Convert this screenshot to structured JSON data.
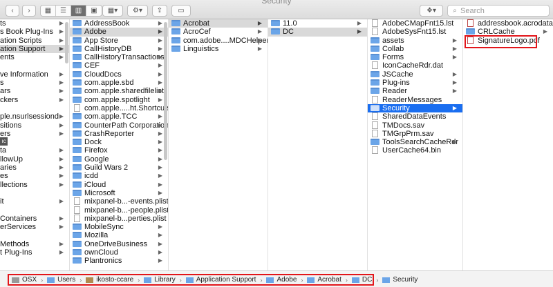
{
  "window": {
    "title": "Security"
  },
  "toolbar": {
    "search_placeholder": "Search",
    "view_icons": [
      "icon-view-icon",
      "list-view-icon",
      "column-view-icon",
      "cover-flow-icon"
    ]
  },
  "columns": [
    {
      "name": "library-column",
      "items": [
        {
          "label": "ts",
          "arrow": true
        },
        {
          "label": "s Book Plug-Ins",
          "arrow": true
        },
        {
          "label": "ation Scripts",
          "arrow": true
        },
        {
          "label": "ation Support",
          "arrow": true,
          "selected": "gray"
        },
        {
          "label": "ents",
          "arrow": true
        },
        {
          "label": "",
          "arrow": false
        },
        {
          "label": "ve Information",
          "arrow": true
        },
        {
          "label": "s",
          "arrow": true
        },
        {
          "label": "ars",
          "arrow": true
        },
        {
          "label": "ckers",
          "arrow": true
        },
        {
          "label": "",
          "arrow": false
        },
        {
          "label": "ple.nsurlsessiond",
          "arrow": true
        },
        {
          "label": "sitions",
          "arrow": true
        },
        {
          "label": "ers",
          "arrow": true
        },
        {
          "label": "",
          "arrow": false
        },
        {
          "label": "ta",
          "arrow": true
        },
        {
          "label": "llowUp",
          "arrow": true
        },
        {
          "label": "aries",
          "arrow": true
        },
        {
          "label": "es",
          "arrow": true
        },
        {
          "label": "llections",
          "arrow": true
        },
        {
          "label": "",
          "arrow": false
        },
        {
          "label": "it",
          "arrow": true
        },
        {
          "label": "",
          "arrow": false
        },
        {
          "label": "Containers",
          "arrow": true
        },
        {
          "label": "erServices",
          "arrow": true
        },
        {
          "label": "",
          "arrow": false
        },
        {
          "label": "Methods",
          "arrow": true
        },
        {
          "label": "t Plug-Ins",
          "arrow": true
        }
      ]
    },
    {
      "name": "application-support-column",
      "items": [
        {
          "label": "AddressBook",
          "arrow": true
        },
        {
          "label": "Adobe",
          "arrow": true,
          "selected": "gray"
        },
        {
          "label": "App Store",
          "arrow": true
        },
        {
          "label": "CallHistoryDB",
          "arrow": true
        },
        {
          "label": "CallHistoryTransactions",
          "arrow": true
        },
        {
          "label": "CEF",
          "arrow": true
        },
        {
          "label": "CloudDocs",
          "arrow": true
        },
        {
          "label": "com.apple.sbd",
          "arrow": true
        },
        {
          "label": "com.apple.sharedfilelist",
          "arrow": true
        },
        {
          "label": "com.apple.spotlight",
          "arrow": true
        },
        {
          "label": "com.apple.....ht.Shortcuts",
          "arrow": false,
          "file": true
        },
        {
          "label": "com.apple.TCC",
          "arrow": true
        },
        {
          "label": "CounterPath Corporation",
          "arrow": true
        },
        {
          "label": "CrashReporter",
          "arrow": true
        },
        {
          "label": "Dock",
          "arrow": true
        },
        {
          "label": "Firefox",
          "arrow": true
        },
        {
          "label": "Google",
          "arrow": true
        },
        {
          "label": "Guild Wars 2",
          "arrow": true
        },
        {
          "label": "icdd",
          "arrow": true
        },
        {
          "label": "iCloud",
          "arrow": true
        },
        {
          "label": "Microsoft",
          "arrow": true
        },
        {
          "label": "mixpanel-b...-events.plist",
          "arrow": false,
          "file": true
        },
        {
          "label": "mixpanel-b...-people.plist",
          "arrow": false,
          "file": true
        },
        {
          "label": "mixpanel-b...perties.plist",
          "arrow": false,
          "file": true
        },
        {
          "label": "MobileSync",
          "arrow": true
        },
        {
          "label": "Mozilla",
          "arrow": true
        },
        {
          "label": "OneDriveBusiness",
          "arrow": true
        },
        {
          "label": "ownCloud",
          "arrow": true
        },
        {
          "label": "Plantronics",
          "arrow": true
        }
      ]
    },
    {
      "name": "adobe-column",
      "items": [
        {
          "label": "Acrobat",
          "arrow": true,
          "selected": "gray"
        },
        {
          "label": "AcroCef",
          "arrow": true
        },
        {
          "label": "com.adobe....MDCHelper",
          "arrow": true
        },
        {
          "label": "Linguistics",
          "arrow": true
        }
      ]
    },
    {
      "name": "acrobat-column",
      "items": [
        {
          "label": "11.0",
          "arrow": true
        },
        {
          "label": "DC",
          "arrow": true,
          "selected": "gray"
        }
      ]
    },
    {
      "name": "dc-column",
      "items": [
        {
          "label": "AdobeCMapFnt15.lst",
          "arrow": false,
          "file": true
        },
        {
          "label": "AdobeSysFnt15.lst",
          "arrow": false,
          "file": true
        },
        {
          "label": "assets",
          "arrow": true
        },
        {
          "label": "Collab",
          "arrow": true
        },
        {
          "label": "Forms",
          "arrow": true
        },
        {
          "label": "IconCacheRdr.dat",
          "arrow": false,
          "file": true
        },
        {
          "label": "JSCache",
          "arrow": true
        },
        {
          "label": "Plug-ins",
          "arrow": true
        },
        {
          "label": "Reader",
          "arrow": true
        },
        {
          "label": "ReaderMessages",
          "arrow": false,
          "file": true
        },
        {
          "label": "Security",
          "arrow": true,
          "selected": "blue"
        },
        {
          "label": "SharedDataEvents",
          "arrow": false,
          "file": true
        },
        {
          "label": "TMDocs.sav",
          "arrow": false,
          "file": true
        },
        {
          "label": "TMGrpPrm.sav",
          "arrow": false,
          "file": true
        },
        {
          "label": "ToolsSearchCacheRdr",
          "arrow": true
        },
        {
          "label": "UserCache64.bin",
          "arrow": false,
          "file": true
        }
      ]
    },
    {
      "name": "security-column",
      "items": [
        {
          "label": "addressbook.acrodata",
          "arrow": false,
          "pdf": true
        },
        {
          "label": "CRLCache",
          "arrow": true
        },
        {
          "label": "SignatureLogo.pdf",
          "arrow": false,
          "pdf": true
        }
      ]
    }
  ],
  "pathbar": {
    "crumbs": [
      {
        "label": "OSX",
        "icon": "disk-icon"
      },
      {
        "label": "Users",
        "icon": "folder-icon"
      },
      {
        "label": "ikosto-ccare",
        "icon": "home-icon"
      },
      {
        "label": "Library",
        "icon": "folder-icon"
      },
      {
        "label": "Application Support",
        "icon": "folder-icon"
      },
      {
        "label": "Adobe",
        "icon": "folder-icon"
      },
      {
        "label": "Acrobat",
        "icon": "folder-icon"
      },
      {
        "label": "DC",
        "icon": "folder-icon"
      },
      {
        "label": "Security",
        "icon": "folder-icon"
      }
    ]
  },
  "colors": {
    "selection_blue": "#1a6ef0",
    "selection_gray": "#d9d9d9",
    "highlight_red": "#e3151a",
    "folder_blue": "#6ba5e8"
  }
}
